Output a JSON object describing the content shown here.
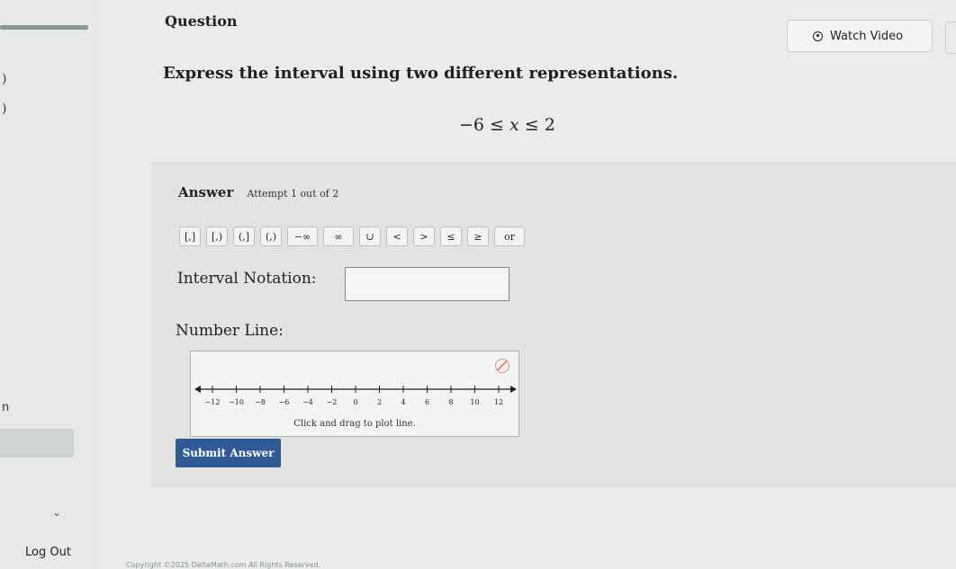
{
  "sidebar": {
    "paren1": ")",
    "paren2": ")",
    "partial_text": "n",
    "logout": "Log Out",
    "copyright": "Copyright ©2025 DeltaMath.com All Rights Reserved."
  },
  "question": {
    "label": "Question",
    "watch_video": "Watch Video",
    "prompt": "Express the interval using two different representations.",
    "inequality": {
      "left": "−6 ≤ ",
      "var": "x",
      "right": " ≤ 2"
    }
  },
  "answer": {
    "title": "Answer",
    "attempt": "Attempt 1 out of 2",
    "toolbar": [
      "[,]",
      "[,)",
      "(,]",
      "(,)",
      "−∞",
      "∞",
      "∪",
      "<",
      ">",
      "≤",
      "≥",
      "or"
    ],
    "interval_label": "Interval Notation:",
    "interval_value": "",
    "number_line_label": "Number Line:",
    "number_line": {
      "ticks": [
        -12,
        -10,
        -8,
        -6,
        -4,
        -2,
        0,
        2,
        4,
        6,
        8,
        10,
        12
      ],
      "hint": "Click and drag to plot line."
    },
    "submit": "Submit Answer"
  },
  "colors": {
    "submit": "#2f5a93",
    "clear_icon": "#e08a8a"
  },
  "icons": {
    "watch": "play-circle-icon",
    "clear": "clear-icon",
    "chevron": "chevron-down-icon"
  }
}
